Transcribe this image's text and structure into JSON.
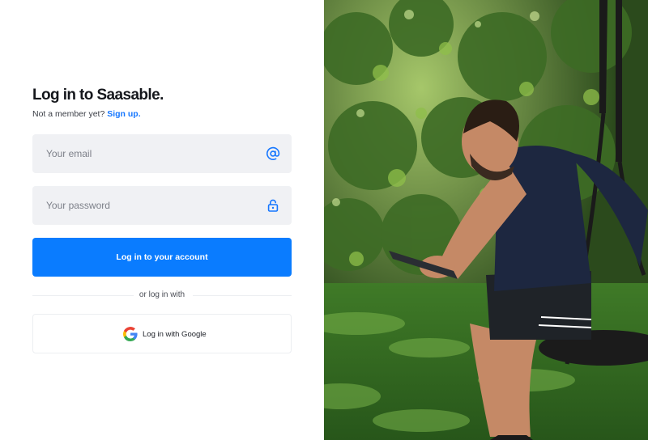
{
  "login": {
    "title": "Log in to Saasable.",
    "subtitle_text": "Not a member yet?",
    "signup_link": "Sign up.",
    "email_placeholder": "Your email",
    "password_placeholder": "Your password",
    "submit_label": "Log in to your account",
    "divider_text": "or log in with",
    "google_label": "Log in with Google"
  },
  "icons": {
    "email": "at-sign-icon",
    "password": "lock-icon",
    "google": "google-logo-icon"
  },
  "colors": {
    "accent": "#0a7cff",
    "field_background": "#f0f1f4",
    "title": "#15171c"
  },
  "hero_image": {
    "subject": "man sitting on a rope swing using a smartphone in a sunny garden"
  }
}
